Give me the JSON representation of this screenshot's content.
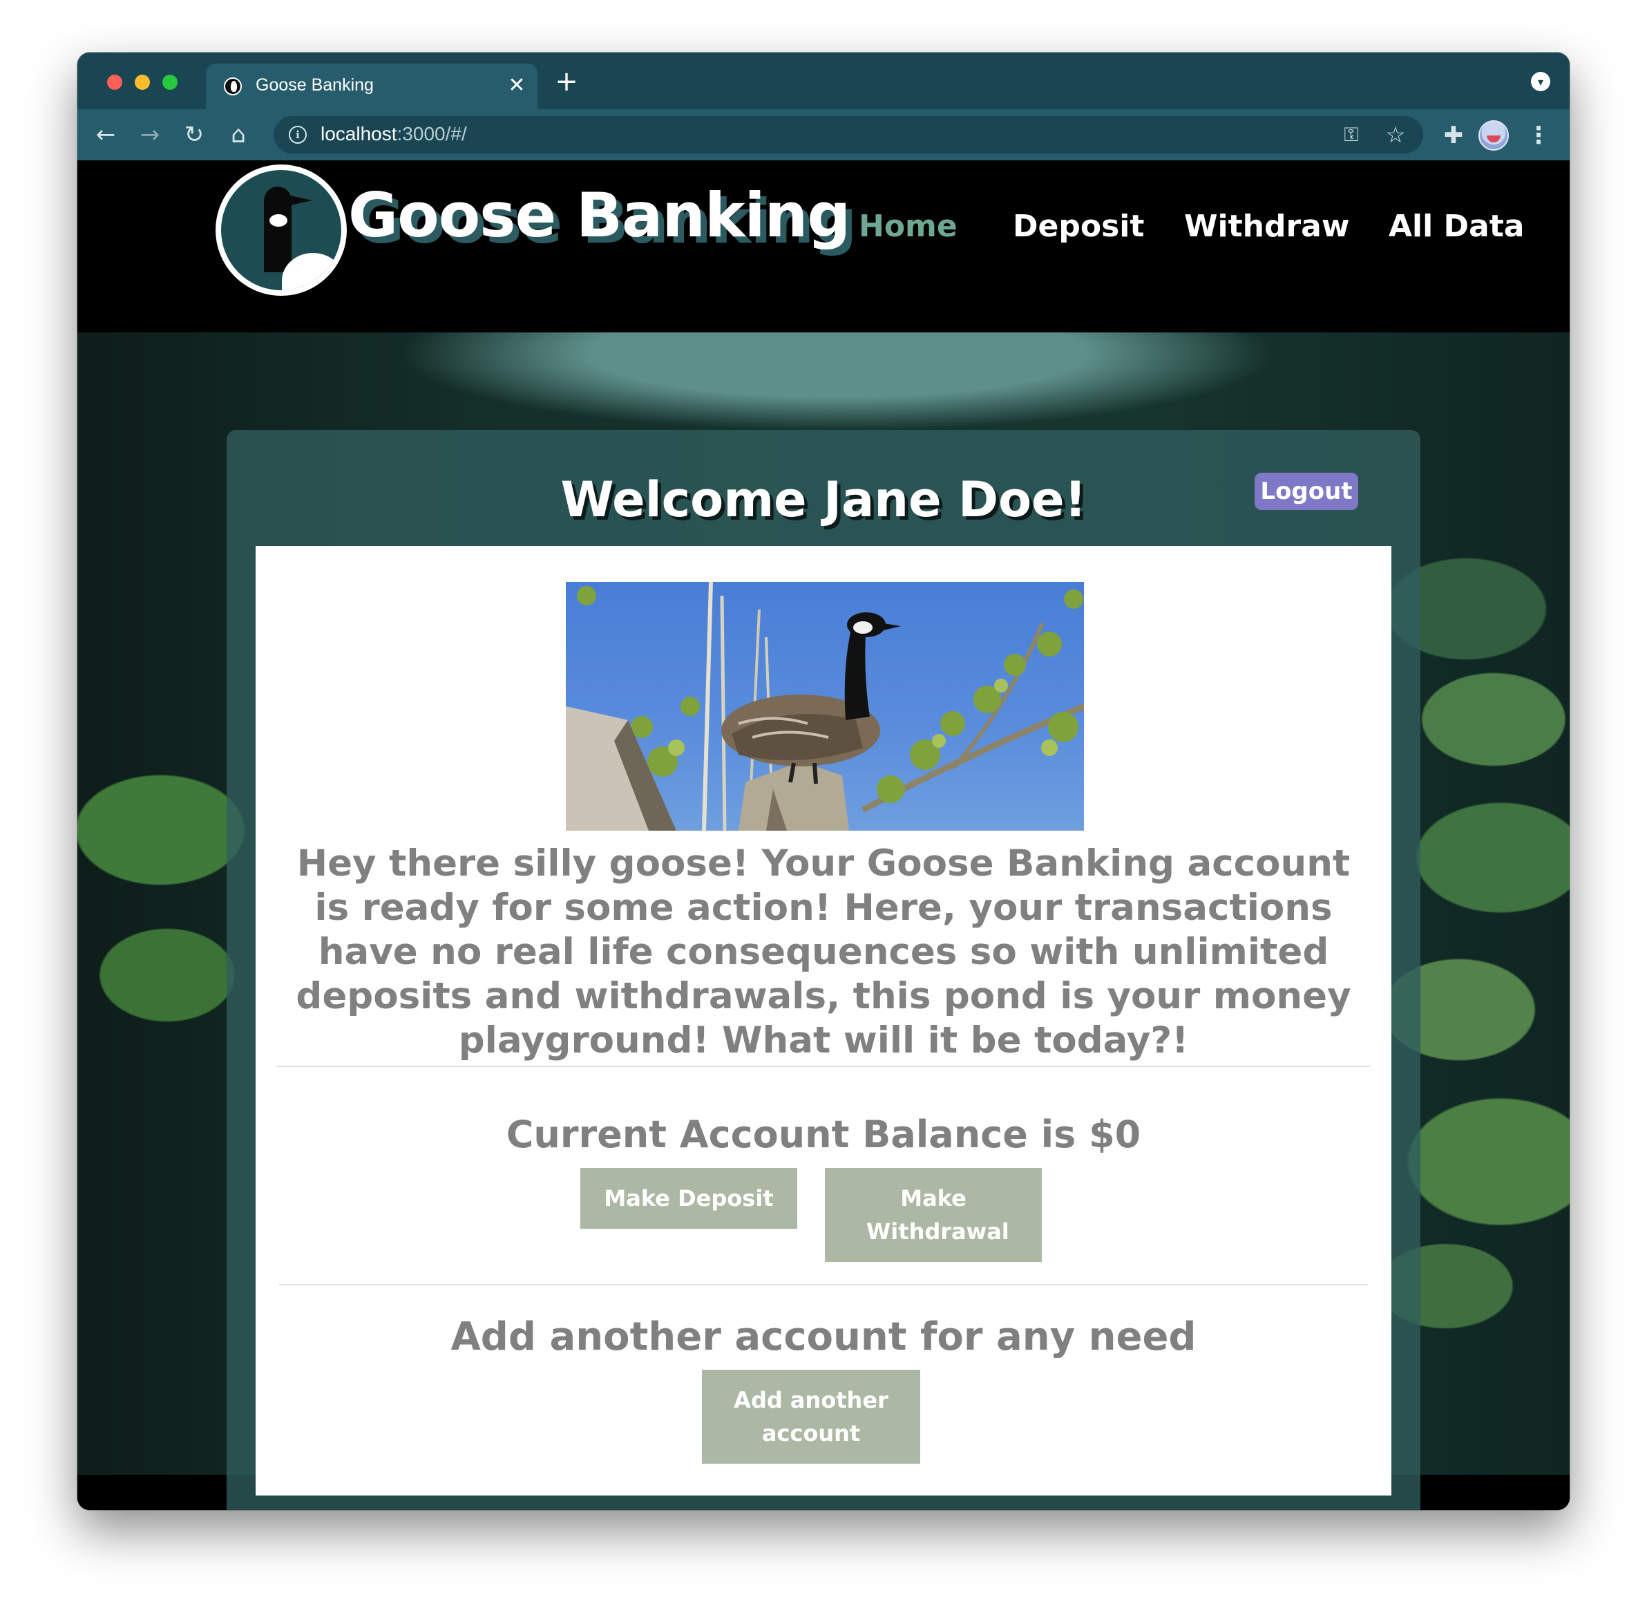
{
  "browser": {
    "tab_title": "Goose Banking",
    "tab_close": "✕",
    "new_tab": "+",
    "url_host": "localhost",
    "url_rest": ":3000/#/",
    "icons": [
      "back-arrow-icon",
      "forward-arrow-icon",
      "reload-icon",
      "home-icon",
      "info-icon",
      "key-icon",
      "star-icon",
      "puzzle-icon",
      "kebab-menu-icon"
    ]
  },
  "navbar": {
    "brand": "Goose Banking",
    "links": [
      "Home",
      "Deposit",
      "Withdraw",
      "All Data"
    ],
    "active_link": "Home"
  },
  "card": {
    "welcome": "Welcome Jane Doe!",
    "logout": "Logout",
    "intro": "Hey there silly goose! Your Goose Banking account is ready for some action! Here, your transactions have no real life consequences so with unlimited deposits and withdrawals, this pond is your money playground! What will it be today?!",
    "balance": "Current Account Balance is $0",
    "deposit_button": "Make Deposit",
    "withdraw_button": "Make Withdrawal",
    "add_heading": "Add another account for any need",
    "add_button": "Add another account"
  },
  "colors": {
    "chrome_dark": "#1a4553",
    "chrome_light": "#265c6b",
    "brand_shadow": "#2b5b60",
    "active_link": "#6fa890",
    "logout_bg": "#7f78c6",
    "button_bg": "#adb8a4",
    "text_gray": "#808080"
  }
}
